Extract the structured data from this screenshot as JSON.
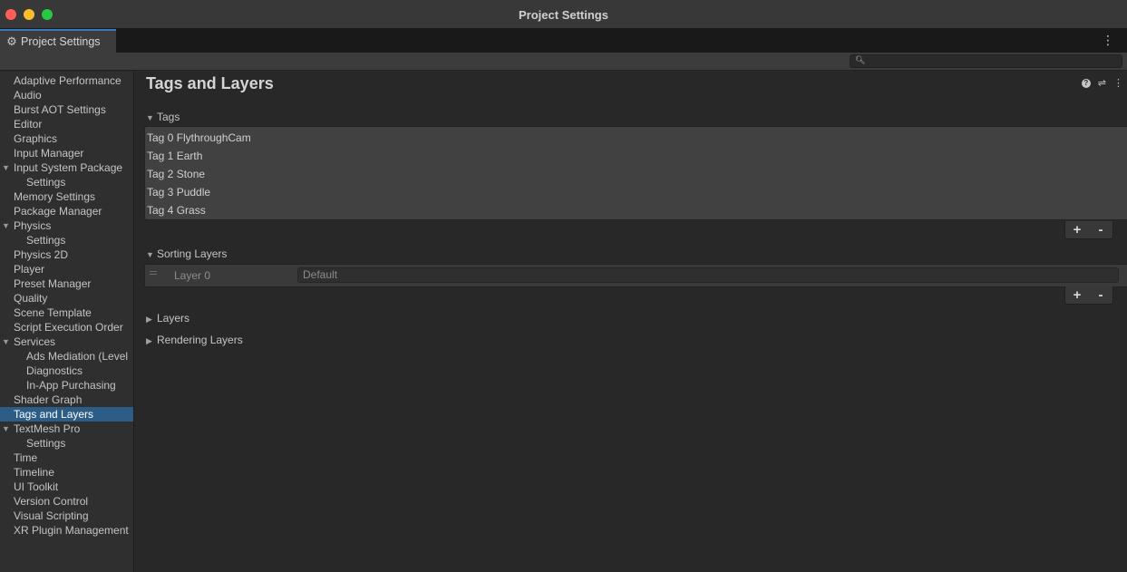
{
  "window": {
    "title": "Project Settings"
  },
  "tab": {
    "label": "Project Settings",
    "icon": "gear-icon",
    "menu_glyph": "⋮"
  },
  "search": {
    "value": "",
    "placeholder": ""
  },
  "sidebar": {
    "items": [
      {
        "label": "Adaptive Performance"
      },
      {
        "label": "Audio"
      },
      {
        "label": "Burst AOT Settings"
      },
      {
        "label": "Editor"
      },
      {
        "label": "Graphics"
      },
      {
        "label": "Input Manager"
      },
      {
        "label": "Input System Package"
      },
      {
        "label": "Settings"
      },
      {
        "label": "Memory Settings"
      },
      {
        "label": "Package Manager"
      },
      {
        "label": "Physics"
      },
      {
        "label": "Settings"
      },
      {
        "label": "Physics 2D"
      },
      {
        "label": "Player"
      },
      {
        "label": "Preset Manager"
      },
      {
        "label": "Quality"
      },
      {
        "label": "Scene Template"
      },
      {
        "label": "Script Execution Order"
      },
      {
        "label": "Services"
      },
      {
        "label": "Ads Mediation (Level"
      },
      {
        "label": "Diagnostics"
      },
      {
        "label": "In-App Purchasing"
      },
      {
        "label": "Shader Graph"
      },
      {
        "label": "Tags and Layers"
      },
      {
        "label": "TextMesh Pro"
      },
      {
        "label": "Settings"
      },
      {
        "label": "Time"
      },
      {
        "label": "Timeline"
      },
      {
        "label": "UI Toolkit"
      },
      {
        "label": "Version Control"
      },
      {
        "label": "Visual Scripting"
      },
      {
        "label": "XR Plugin Management"
      }
    ],
    "selected": "Tags and Layers"
  },
  "main": {
    "title": "Tags and Layers",
    "tags": {
      "header": "Tags",
      "items": [
        "Tag 0 FlythroughCam",
        "Tag 1 Earth",
        "Tag 2 Stone",
        "Tag 3 Puddle",
        "Tag 4 Grass"
      ]
    },
    "sorting_layers": {
      "header": "Sorting Layers",
      "items": [
        {
          "name": "Layer 0",
          "value": "Default"
        }
      ]
    },
    "layers": {
      "header": "Layers"
    },
    "rendering_layers": {
      "header": "Rendering Layers"
    },
    "add_label": "+",
    "remove_label": "-"
  },
  "colors": {
    "accent": "#2c5d87",
    "tab_accent": "#3a79bb",
    "background": "#282828",
    "traffic_close": "#fe5f57",
    "traffic_min": "#febc2e",
    "traffic_max": "#28c840"
  }
}
